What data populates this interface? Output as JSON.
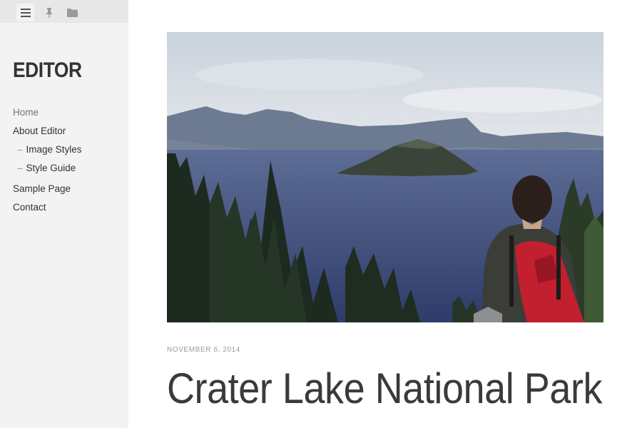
{
  "sidebar": {
    "tabs": [
      {
        "icon": "menu-icon",
        "active": true
      },
      {
        "icon": "pin-icon",
        "active": false
      },
      {
        "icon": "folder-icon",
        "active": false
      }
    ],
    "site_title": "EDITOR",
    "menu": [
      {
        "label": "Home",
        "level": 0
      },
      {
        "label": "About Editor",
        "level": 0
      },
      {
        "label": "Image Styles",
        "level": 1
      },
      {
        "label": "Style Guide",
        "level": 1
      },
      {
        "label": "Sample Page",
        "level": 0
      },
      {
        "label": "Contact",
        "level": 0
      }
    ],
    "submenu_prefix": "–"
  },
  "post": {
    "date": "NOVEMBER 6, 2014",
    "title": "Crater Lake National Park",
    "featured_image": "crater-lake-photo"
  },
  "colors": {
    "sidebar_bg": "#f3f3f3",
    "tab_bar_bg": "#e7e7e7",
    "text": "#333333",
    "muted": "#999999"
  }
}
